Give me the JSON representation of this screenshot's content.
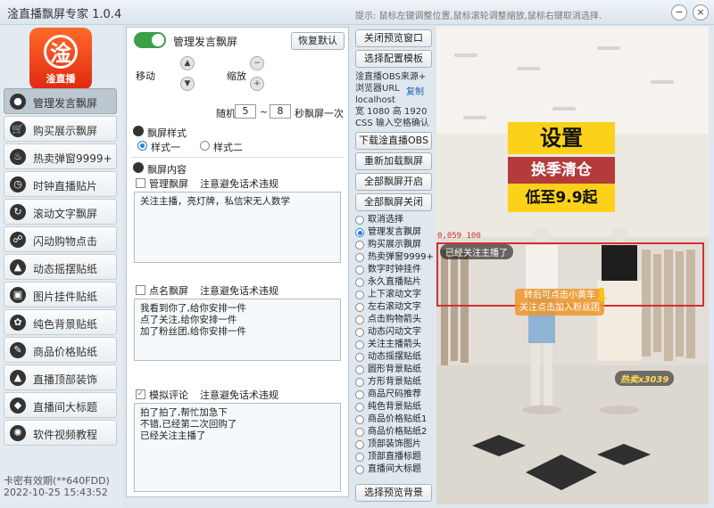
{
  "window": {
    "title": "淦直播飘屏专家 1.0.4",
    "hint": "提示: 鼠标左键调整位置,鼠标滚轮调整缩放,鼠标右键取消选择.",
    "minimize": "−",
    "close": "×"
  },
  "logo": {
    "char": "淦",
    "text": "淦直播"
  },
  "sidebar": {
    "items": [
      {
        "label": "管理发言飘屏",
        "icon": "user-icon",
        "glyph": "●"
      },
      {
        "label": "购买展示飘屏",
        "icon": "cart-icon",
        "glyph": "🛒"
      },
      {
        "label": "热卖弹窗9999+",
        "icon": "flame-icon",
        "glyph": "♨"
      },
      {
        "label": "时钟直播贴片",
        "icon": "clock-icon",
        "glyph": "◷"
      },
      {
        "label": "滚动文字飘屏",
        "icon": "scroll-icon",
        "glyph": "↻"
      },
      {
        "label": "闪动购物点击",
        "icon": "flash-icon",
        "glyph": "☍"
      },
      {
        "label": "动态摇摆贴纸",
        "icon": "sticker-icon",
        "glyph": "▲"
      },
      {
        "label": "图片挂件贴纸",
        "icon": "image-icon",
        "glyph": "▣"
      },
      {
        "label": "纯色背景贴纸",
        "icon": "palette-icon",
        "glyph": "✿"
      },
      {
        "label": "商品价格贴纸",
        "icon": "price-tag-icon",
        "glyph": "✎"
      },
      {
        "label": "直播顶部装饰",
        "icon": "arrow-up-icon",
        "glyph": "▲"
      },
      {
        "label": "直播间大标题",
        "icon": "title-icon",
        "glyph": "◆"
      },
      {
        "label": "软件视频教程",
        "icon": "video-icon",
        "glyph": "✺"
      }
    ],
    "license": "卡密有效期(**640FDD)",
    "datetime": "2022-10-25 15:43:52"
  },
  "panel": {
    "header": "管理发言飘屏",
    "reset": "恢复默认",
    "move": "移动",
    "zoom": "缩放",
    "random_label": "随机",
    "random_min": "5",
    "random_sep": "~",
    "random_max": "8",
    "random_suffix": "秒飘屏一次",
    "style_title": "飘屏样式",
    "style_options": [
      "样式一",
      "样式二"
    ],
    "content_title": "飘屏内容",
    "sections": [
      {
        "label": "管理飘屏",
        "note": "注意避免话术违规",
        "checked": false,
        "lines": [
          "关注主播，亮灯牌，私信宋无人数学"
        ]
      },
      {
        "label": "点名飘屏",
        "note": "注意避免话术违规",
        "checked": false,
        "lines": [
          "我看到你了,给你安排一件",
          "点了关注,给你安排一件",
          "加了粉丝团,给你安排一件"
        ]
      },
      {
        "label": "模拟评论",
        "note": "注意避免话术违规",
        "checked": true,
        "lines": [
          "拍了拍了,帮忙加急下",
          "不错,已经第二次回购了",
          "已经关注主播了"
        ]
      }
    ]
  },
  "controls": {
    "close_preview": "关闭预览窗口",
    "select_template": "选择配置模板",
    "obs_info": [
      "淦直播OBS来源+",
      "浏览器URL",
      "localhost",
      "宽 1080 高 1920",
      "CSS 输入空格确认"
    ],
    "copy": "复制",
    "download_obs": "下载淦直播OBS",
    "reload": "重新加载飘屏",
    "open_all": "全部飘屏开启",
    "close_all": "全部飘屏关闭",
    "list": [
      "取消选择",
      "管理发言飘屏",
      "购买展示飘屏",
      "热卖弹窗9999+",
      "数字时钟挂件",
      "永久直播贴片",
      "上下滚动文字",
      "左右滚动文字",
      "点击购物箭头",
      "动态闪动文字",
      "关注主播箭头",
      "动态摇摆贴纸",
      "圆形背景贴纸",
      "方形背景贴纸",
      "商品尺码推荐",
      "纯色背景贴纸",
      "商品价格贴纸1",
      "商品价格贴纸2",
      "顶部装饰图片",
      "顶部直播标题",
      "直播间大标题"
    ],
    "selected_index": 1,
    "select_bg": "选择预览背景"
  },
  "preview": {
    "title_main": "设置",
    "title_sub": "换季清仓",
    "title_price": "低至9.9起",
    "coord_label": "0,059  100",
    "bubble": "已经关注主播了",
    "ticker_line1": "转后可点击小黄车",
    "ticker_line2": "关注点击加入粉丝团",
    "hot": "热卖x3039",
    "colors": {
      "title_bg": "#fbd11a",
      "sub_bg": "#b33b3b",
      "selection": "#d23030"
    }
  }
}
